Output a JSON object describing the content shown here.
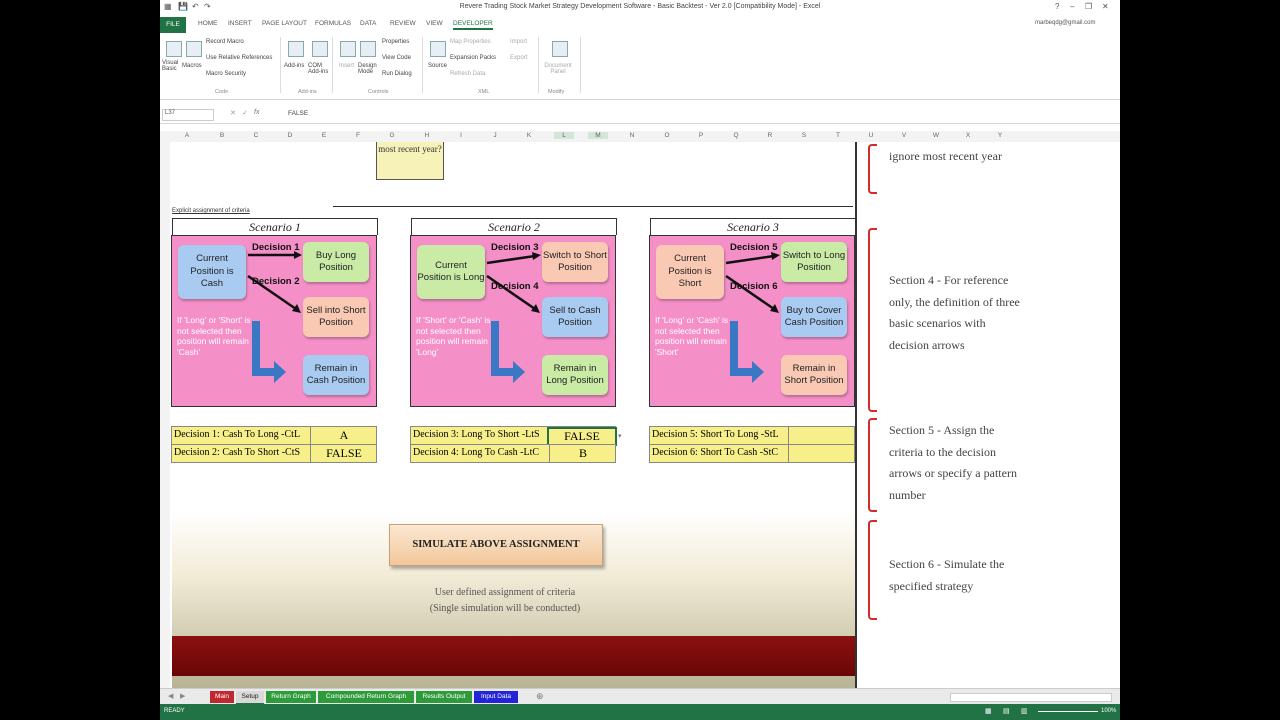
{
  "window": {
    "title": "Revere Trading Stock Market Strategy Development Software - Basic Backtest - Ver 2.0  [Compatibility Mode] - Excel",
    "user": "marbeqdg@gmail.com"
  },
  "ribbon_tabs": [
    "FILE",
    "HOME",
    "INSERT",
    "PAGE LAYOUT",
    "FORMULAS",
    "DATA",
    "REVIEW",
    "VIEW",
    "DEVELOPER"
  ],
  "ribbon": {
    "visual_basic": "Visual Basic",
    "macros": "Macros",
    "record_macro": "Record Macro",
    "relative_refs": "Use Relative References",
    "macro_security": "Macro Security",
    "code_group": "Code",
    "addins": "Add-ins",
    "com_addins": "COM Add-ins",
    "addins_group": "Add-ins",
    "insert": "Insert",
    "design_mode": "Design Mode",
    "properties": "Properties",
    "view_code": "View Code",
    "run_dialog": "Run Dialog",
    "controls_group": "Controls",
    "source": "Source",
    "map_properties": "Map Properties",
    "expansion_packs": "Expansion Packs",
    "refresh_data": "Refresh Data",
    "import": "Import",
    "export": "Export",
    "xml_group": "XML",
    "document_panel": "Document Panel",
    "modify_group": "Modify"
  },
  "formula_bar": {
    "name_box": "L37",
    "fx": "fx",
    "value": "FALSE"
  },
  "columns": [
    "A",
    "B",
    "C",
    "D",
    "E",
    "F",
    "G",
    "H",
    "I",
    "J",
    "K",
    "L",
    "M",
    "N",
    "O",
    "P",
    "Q",
    "R",
    "S",
    "T",
    "U",
    "V",
    "W",
    "X",
    "Y"
  ],
  "sheet": {
    "top_callout": "most recent year?",
    "section_label": "Explicit assignment of criteria",
    "scenarios": [
      {
        "title": "Scenario 1",
        "current": "Current Position is Cash",
        "top_decision": "Decision 1",
        "mid_decision": "Decision 2",
        "top_action": "Buy Long Position",
        "mid_action": "Sell into Short Position",
        "remain": "Remain in Cash Position",
        "note": "If 'Long' or 'Short' is not selected then position will remain 'Cash'"
      },
      {
        "title": "Scenario 2",
        "current": "Current Position is Long",
        "top_decision": "Decision 3",
        "mid_decision": "Decision 4",
        "top_action": "Switch to Short Position",
        "mid_action": "Sell to Cash Position",
        "remain": "Remain in Long Position",
        "note": "If 'Short' or 'Cash' is not selected then position will remain 'Long'"
      },
      {
        "title": "Scenario 3",
        "current": "Current Position is Short",
        "top_decision": "Decision 5",
        "mid_decision": "Decision 6",
        "top_action": "Switch to Long Position",
        "mid_action": "Buy to Cover Cash Position",
        "remain": "Remain in Short Position",
        "note": "If 'Long' or 'Cash' is not selected then position will remain 'Short'"
      }
    ],
    "decision_rows": [
      {
        "label": "Decision 1: Cash To Long -CtL",
        "value": "A"
      },
      {
        "label": "Decision 2: Cash To Short -CtS",
        "value": "FALSE"
      },
      {
        "label": "Decision 3: Long To Short -LtS",
        "value": "FALSE"
      },
      {
        "label": "Decision 4: Long To Cash -LtC",
        "value": "B"
      },
      {
        "label": "Decision 5: Short To Long -StL",
        "value": ""
      },
      {
        "label": "Decision 6: Short To Cash -StC",
        "value": ""
      }
    ],
    "simulate_button": "SIMULATE ABOVE ASSIGNMENT",
    "simulate_caption_1": "User defined assignment of criteria",
    "simulate_caption_2": "(Single simulation will be conducted)",
    "side_notes": [
      "ignore most recent year",
      "Section 4 - For reference only, the definition of three basic scenarios with decision arrows",
      "Section 5 - Assign the criteria to the decision arrows or specify a pattern number",
      "Section 6 - Simulate the specified strategy"
    ]
  },
  "sheet_tabs": [
    {
      "label": "Main",
      "color": "#c0282f"
    },
    {
      "label": "Setup",
      "color": "#d9d9d9"
    },
    {
      "label": "Return Graph",
      "color": "#2e9b3a"
    },
    {
      "label": "Compounded Return Graph",
      "color": "#2e9b3a"
    },
    {
      "label": "Results Output",
      "color": "#2e9b3a"
    },
    {
      "label": "Input Data",
      "color": "#2323d9"
    }
  ],
  "status": {
    "ready": "READY",
    "zoom": "100%"
  }
}
